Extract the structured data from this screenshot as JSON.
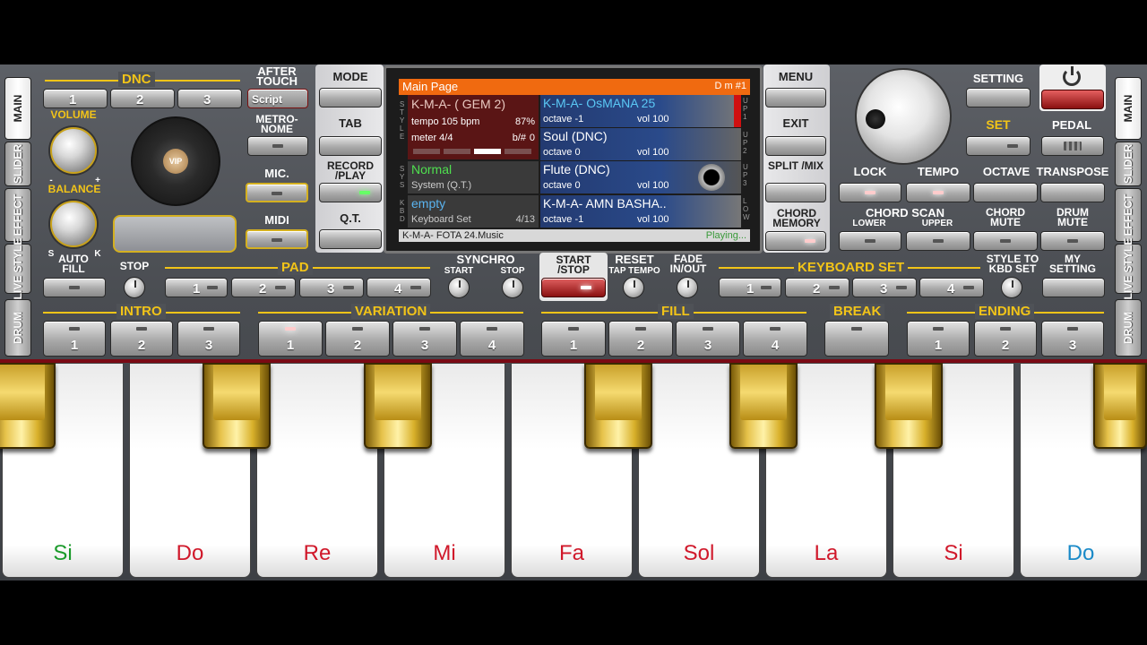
{
  "side_tabs_left": [
    {
      "label": "MAIN",
      "active": true
    },
    {
      "label": "SLIDER",
      "active": false
    },
    {
      "label": "EFFECT",
      "active": false
    },
    {
      "label": "LIVE STYLE",
      "active": false
    },
    {
      "label": "DRUM",
      "active": false
    }
  ],
  "side_tabs_right": [
    {
      "label": "MAIN",
      "active": true
    },
    {
      "label": "SLIDER",
      "active": false
    },
    {
      "label": "EFFECT",
      "active": false
    },
    {
      "label": "LIVE STYLE",
      "active": false
    },
    {
      "label": "DRUM",
      "active": false
    }
  ],
  "dnc": {
    "label": "DNC",
    "buttons": [
      "1",
      "2",
      "3"
    ]
  },
  "after_touch": {
    "label": "AFTER TOUCH",
    "value": "Script"
  },
  "volume_label": "VOLUME",
  "balance_label": "BALANCE",
  "balance_s": "S",
  "balance_k": "K",
  "volume_minus": "-",
  "volume_plus": "+",
  "logo_text": "VIP",
  "metronome_label": "METRO- NOME",
  "mic_label": "MIC.",
  "midi_label": "MIDI",
  "center_buttons": {
    "mode": "MODE",
    "tab": "TAB",
    "record": "RECORD /PLAY",
    "qt": "Q.T."
  },
  "right_col_buttons": {
    "menu": "MENU",
    "exit": "EXIT",
    "split": "SPLIT /MIX",
    "chord_memory": "CHORD MEMORY"
  },
  "setting_label": "SETTING",
  "set_label": "SET",
  "pedal_label": "PEDAL",
  "lock_label": "LOCK",
  "tempo_label": "TEMPO",
  "octave_label": "OCTAVE",
  "transpose_label": "TRANSPOSE",
  "chord_scan_label": "CHORD SCAN",
  "lower_label": "LOWER",
  "upper_label": "UPPER",
  "chord_mute_label": "CHORD MUTE",
  "drum_mute_label": "DRUM MUTE",
  "screen": {
    "header": "Main Page",
    "header_right": "D m #1",
    "style_side": "STYLE",
    "sys_side": "SYS",
    "kbd_side": "KBD",
    "style_name": "K-M-A- ( GEM 2)",
    "tempo": "tempo 105 bpm",
    "tempo_pct": "87%",
    "meter": "meter 4/4",
    "bsharp": "b/#",
    "bsharp_val": "0",
    "sys_name": "Normal",
    "sys_sub": "System (Q.T.)",
    "kbd_name": "empty",
    "kbd_sub": "Keyboard Set",
    "kbd_count": "4/13",
    "up1_name": "K-M-A- OsMANA 25",
    "up1_oct": "octave -1",
    "up1_vol": "vol 100",
    "up1_side": "UP1",
    "up2_name": "Soul (DNC)",
    "up2_oct": "octave  0",
    "up2_vol": "vol 100",
    "up2_side": "UP2",
    "up3_name": "Flute (DNC)",
    "up3_oct": "octave  0",
    "up3_vol": "vol 100",
    "up3_side": "UP3",
    "low_name": "K-M-A- AMN BASHA..",
    "low_oct": "octave -1",
    "low_vol": "vol 100",
    "low_side": "LOW",
    "footer": "K-M-A- FOTA 24.Music",
    "footer_status": "Playing..."
  },
  "auto_fill_label": "AUTO FILL",
  "stop_label": "STOP",
  "pad": {
    "label": "PAD",
    "buttons": [
      "1",
      "2",
      "3",
      "4"
    ]
  },
  "synchro_label": "SYNCHRO",
  "synchro_start": "START",
  "synchro_stop": "STOP",
  "start_stop_label": "START /STOP",
  "reset_label": "RESET",
  "tap_tempo_label": "TAP TEMPO",
  "fade_label": "FADE IN/OUT",
  "keyboard_set": {
    "label": "KEYBOARD SET",
    "buttons": [
      "1",
      "2",
      "3",
      "4"
    ]
  },
  "style_to_kbd_label": "STYLE TO KBD SET",
  "my_setting_label": "MY SETTING",
  "intro": {
    "label": "INTRO",
    "buttons": [
      "1",
      "2",
      "3"
    ]
  },
  "variation": {
    "label": "VARIATION",
    "buttons": [
      "1",
      "2",
      "3",
      "4"
    ]
  },
  "fill": {
    "label": "FILL",
    "buttons": [
      "1",
      "2",
      "3",
      "4"
    ]
  },
  "break_label": "BREAK",
  "ending": {
    "label": "ENDING",
    "buttons": [
      "1",
      "2",
      "3"
    ]
  },
  "keys": [
    {
      "note": "Si",
      "color": "#1a9a2a"
    },
    {
      "note": "Do",
      "color": "#d0182a"
    },
    {
      "note": "Re",
      "color": "#d0182a"
    },
    {
      "note": "Mi",
      "color": "#d0182a"
    },
    {
      "note": "Fa",
      "color": "#d0182a"
    },
    {
      "note": "Sol",
      "color": "#d0182a"
    },
    {
      "note": "La",
      "color": "#d0182a"
    },
    {
      "note": "Si",
      "color": "#d0182a"
    },
    {
      "note": "Do",
      "color": "#1a8ac8"
    }
  ]
}
